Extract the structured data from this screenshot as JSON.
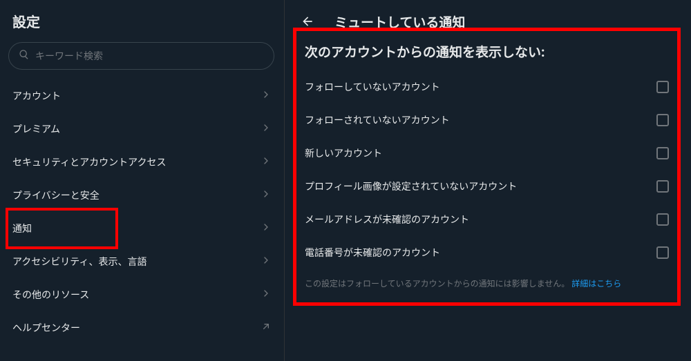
{
  "sidebar": {
    "title": "設定",
    "search_placeholder": "キーワード検索",
    "items": [
      {
        "label": "アカウント",
        "kind": "chev",
        "name": "nav-account"
      },
      {
        "label": "プレミアム",
        "kind": "chev",
        "name": "nav-premium"
      },
      {
        "label": "セキュリティとアカウントアクセス",
        "kind": "chev",
        "name": "nav-security"
      },
      {
        "label": "プライバシーと安全",
        "kind": "chev",
        "name": "nav-privacy"
      },
      {
        "label": "通知",
        "kind": "chev",
        "name": "nav-notifications",
        "highlight": true
      },
      {
        "label": "アクセシビリティ、表示、言語",
        "kind": "chev",
        "name": "nav-accessibility"
      },
      {
        "label": "その他のリソース",
        "kind": "chev",
        "name": "nav-other"
      },
      {
        "label": "ヘルプセンター",
        "kind": "ext",
        "name": "nav-help"
      }
    ]
  },
  "main": {
    "title": "ミュートしている通知",
    "section_heading": "次のアカウントからの通知を表示しない:",
    "options": [
      {
        "label": "フォローしていないアカウント",
        "name": "opt-not-following"
      },
      {
        "label": "フォローされていないアカウント",
        "name": "opt-not-followed"
      },
      {
        "label": "新しいアカウント",
        "name": "opt-new-account"
      },
      {
        "label": "プロフィール画像が設定されていないアカウント",
        "name": "opt-no-avatar"
      },
      {
        "label": "メールアドレスが未確認のアカウント",
        "name": "opt-no-email"
      },
      {
        "label": "電話番号が未確認のアカウント",
        "name": "opt-no-phone"
      }
    ],
    "note_text": "この設定はフォローしているアカウントからの通知には影響しません。",
    "note_link": "詳細はこちら"
  }
}
